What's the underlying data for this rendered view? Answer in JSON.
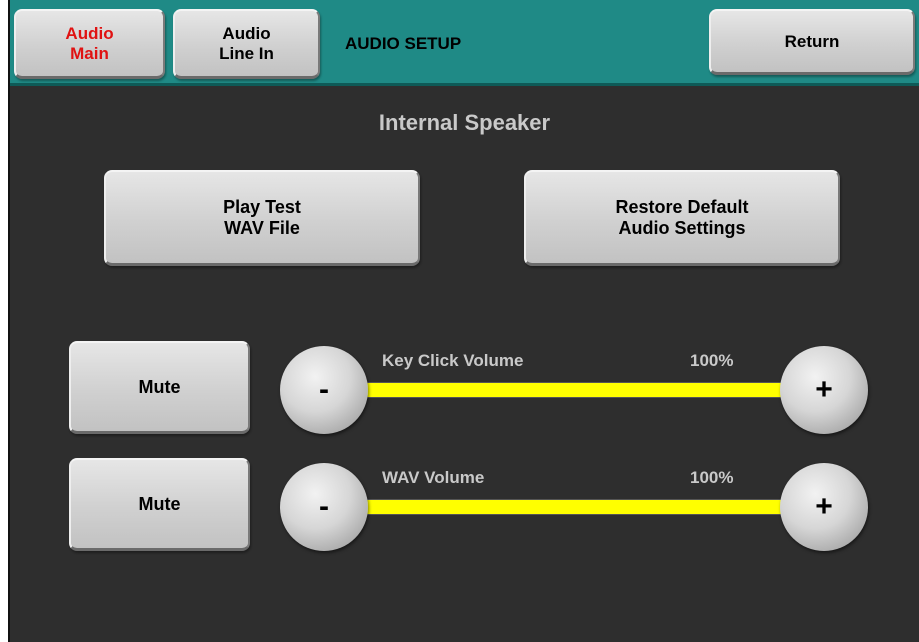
{
  "header": {
    "tabs": [
      {
        "label": "Audio\nMain",
        "active": true
      },
      {
        "label": "Audio\nLine In",
        "active": false
      }
    ],
    "title": "AUDIO SETUP",
    "return_label": "Return"
  },
  "section": {
    "title": "Internal Speaker"
  },
  "actions": {
    "play_test_label": "Play Test\nWAV File",
    "restore_defaults_label": "Restore Default\nAudio Settings"
  },
  "volumes": [
    {
      "name": "Key Click Volume",
      "percent_label": "100%",
      "level": 1.0,
      "mute_label": "Mute",
      "minus_label": "-",
      "plus_label": "+"
    },
    {
      "name": "WAV Volume",
      "percent_label": "100%",
      "level": 1.0,
      "mute_label": "Mute",
      "minus_label": "-",
      "plus_label": "+"
    }
  ],
  "colors": {
    "header_bg": "#1f8a86",
    "screen_bg": "#2e2e2e",
    "active_tab_text": "#e01212",
    "volume_fill": "#ffff00",
    "label_text": "#c9c9c9"
  }
}
